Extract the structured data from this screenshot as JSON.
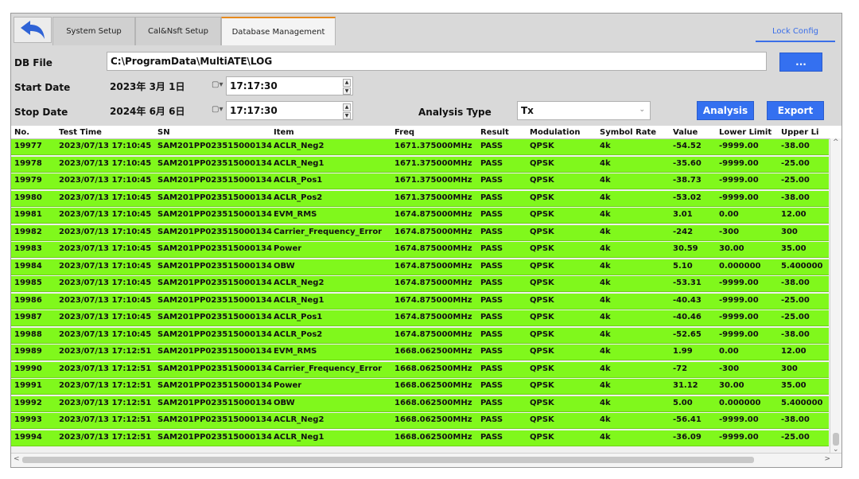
{
  "tabs": [
    {
      "label": "System Setup",
      "active": false
    },
    {
      "label": "Cal&Nsft Setup",
      "active": false
    },
    {
      "label": "Database Management",
      "active": true
    }
  ],
  "lock_config": "Lock Config",
  "db_file": {
    "label": "DB File",
    "value": "C:\\ProgramData\\MultiATE\\LOG",
    "browse_label": "..."
  },
  "start": {
    "label": "Start Date",
    "date": "2023年 3月 1日",
    "time": "17:17:30"
  },
  "stop": {
    "label": "Stop Date",
    "date": "2024年 6月 6日",
    "time": "17:17:30"
  },
  "analysis_type": {
    "label": "Analysis Type",
    "value": "Tx"
  },
  "buttons": {
    "analysis": "Analysis",
    "export": "Export"
  },
  "icons": {
    "back": "back-arrow-icon",
    "calendar": "calendar-dropdown-icon"
  },
  "colors": {
    "row_pass": "#80f81c",
    "accent": "#3470f0",
    "active_tab": "#e68a1f"
  },
  "table": {
    "headers": [
      "No.",
      "Test Time",
      "SN",
      "Item",
      "Freq",
      "Result",
      "Modulation",
      "Symbol Rate",
      "Value",
      "Lower Limit",
      "Upper Li"
    ],
    "rows": [
      [
        "19977",
        "2023/07/13 17:10:45",
        "SAM201PP023515000134",
        "ACLR_Neg2",
        "1671.375000MHz",
        "PASS",
        "QPSK",
        "4k",
        "-54.52",
        "-9999.00",
        "-38.00"
      ],
      [
        "19978",
        "2023/07/13 17:10:45",
        "SAM201PP023515000134",
        "ACLR_Neg1",
        "1671.375000MHz",
        "PASS",
        "QPSK",
        "4k",
        "-35.60",
        "-9999.00",
        "-25.00"
      ],
      [
        "19979",
        "2023/07/13 17:10:45",
        "SAM201PP023515000134",
        "ACLR_Pos1",
        "1671.375000MHz",
        "PASS",
        "QPSK",
        "4k",
        "-38.73",
        "-9999.00",
        "-25.00"
      ],
      [
        "19980",
        "2023/07/13 17:10:45",
        "SAM201PP023515000134",
        "ACLR_Pos2",
        "1671.375000MHz",
        "PASS",
        "QPSK",
        "4k",
        "-53.02",
        "-9999.00",
        "-38.00"
      ],
      [
        "19981",
        "2023/07/13 17:10:45",
        "SAM201PP023515000134",
        "EVM_RMS",
        "1674.875000MHz",
        "PASS",
        "QPSK",
        "4k",
        "3.01",
        "0.00",
        "12.00"
      ],
      [
        "19982",
        "2023/07/13 17:10:45",
        "SAM201PP023515000134",
        "Carrier_Frequency_Error",
        "1674.875000MHz",
        "PASS",
        "QPSK",
        "4k",
        "-242",
        "-300",
        "300"
      ],
      [
        "19983",
        "2023/07/13 17:10:45",
        "SAM201PP023515000134",
        "Power",
        "1674.875000MHz",
        "PASS",
        "QPSK",
        "4k",
        "30.59",
        "30.00",
        "35.00"
      ],
      [
        "19984",
        "2023/07/13 17:10:45",
        "SAM201PP023515000134",
        "OBW",
        "1674.875000MHz",
        "PASS",
        "QPSK",
        "4k",
        "5.10",
        "0.000000",
        "5.400000"
      ],
      [
        "19985",
        "2023/07/13 17:10:45",
        "SAM201PP023515000134",
        "ACLR_Neg2",
        "1674.875000MHz",
        "PASS",
        "QPSK",
        "4k",
        "-53.31",
        "-9999.00",
        "-38.00"
      ],
      [
        "19986",
        "2023/07/13 17:10:45",
        "SAM201PP023515000134",
        "ACLR_Neg1",
        "1674.875000MHz",
        "PASS",
        "QPSK",
        "4k",
        "-40.43",
        "-9999.00",
        "-25.00"
      ],
      [
        "19987",
        "2023/07/13 17:10:45",
        "SAM201PP023515000134",
        "ACLR_Pos1",
        "1674.875000MHz",
        "PASS",
        "QPSK",
        "4k",
        "-40.46",
        "-9999.00",
        "-25.00"
      ],
      [
        "19988",
        "2023/07/13 17:10:45",
        "SAM201PP023515000134",
        "ACLR_Pos2",
        "1674.875000MHz",
        "PASS",
        "QPSK",
        "4k",
        "-52.65",
        "-9999.00",
        "-38.00"
      ],
      [
        "19989",
        "2023/07/13 17:12:51",
        "SAM201PP023515000134",
        "EVM_RMS",
        "1668.062500MHz",
        "PASS",
        "QPSK",
        "4k",
        "1.99",
        "0.00",
        "12.00"
      ],
      [
        "19990",
        "2023/07/13 17:12:51",
        "SAM201PP023515000134",
        "Carrier_Frequency_Error",
        "1668.062500MHz",
        "PASS",
        "QPSK",
        "4k",
        "-72",
        "-300",
        "300"
      ],
      [
        "19991",
        "2023/07/13 17:12:51",
        "SAM201PP023515000134",
        "Power",
        "1668.062500MHz",
        "PASS",
        "QPSK",
        "4k",
        "31.12",
        "30.00",
        "35.00"
      ],
      [
        "19992",
        "2023/07/13 17:12:51",
        "SAM201PP023515000134",
        "OBW",
        "1668.062500MHz",
        "PASS",
        "QPSK",
        "4k",
        "5.00",
        "0.000000",
        "5.400000"
      ],
      [
        "19993",
        "2023/07/13 17:12:51",
        "SAM201PP023515000134",
        "ACLR_Neg2",
        "1668.062500MHz",
        "PASS",
        "QPSK",
        "4k",
        "-56.41",
        "-9999.00",
        "-38.00"
      ],
      [
        "19994",
        "2023/07/13 17:12:51",
        "SAM201PP023515000134",
        "ACLR_Neg1",
        "1668.062500MHz",
        "PASS",
        "QPSK",
        "4k",
        "-36.09",
        "-9999.00",
        "-25.00"
      ]
    ]
  }
}
